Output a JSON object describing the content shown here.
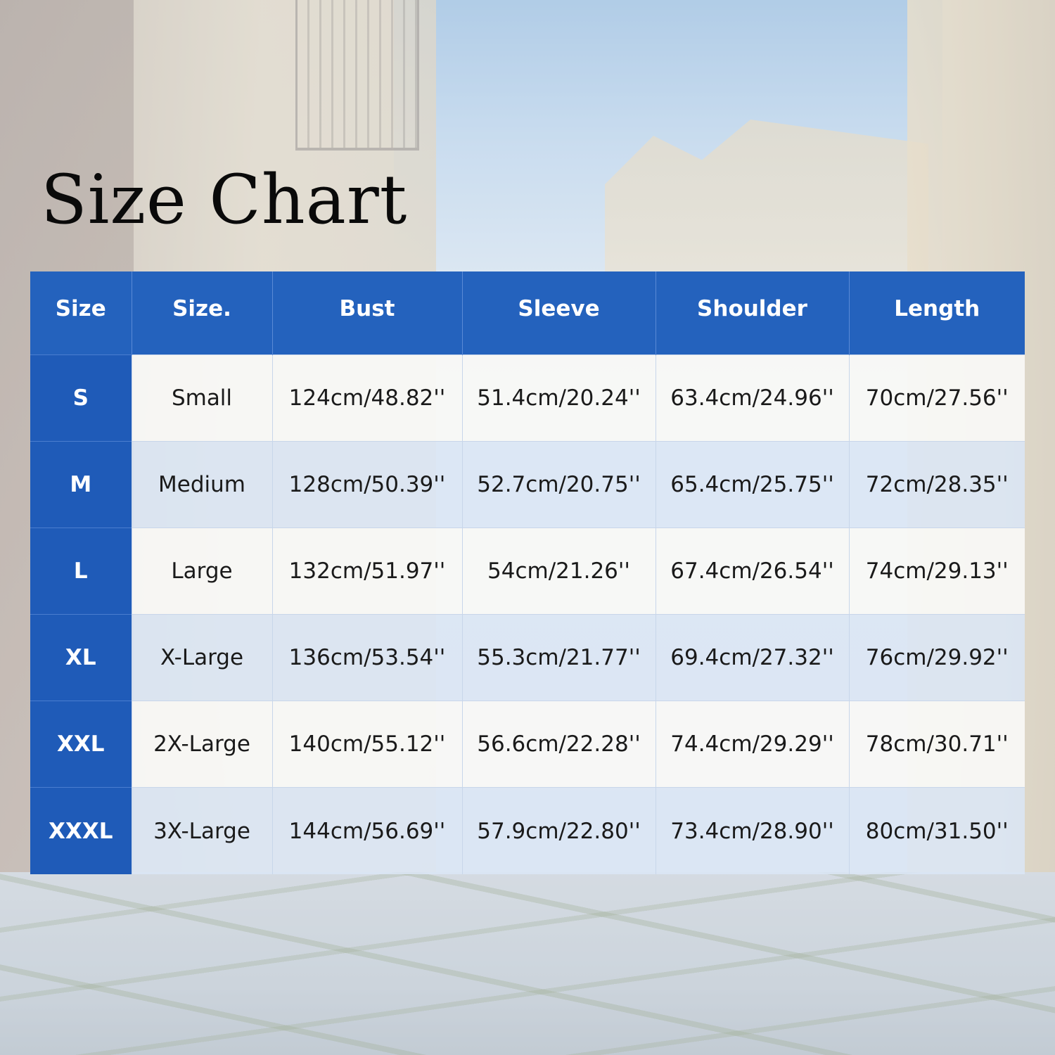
{
  "title": "Size Chart",
  "colors": {
    "header_blue": "#2462bd",
    "size_column_blue": "#1f5bb8",
    "row_light": "#f8f8f6",
    "row_tint": "#dbe6f5"
  },
  "table": {
    "headers": [
      "Size",
      "Size.",
      "Bust",
      "Sleeve",
      "Shoulder",
      "Length"
    ],
    "rows": [
      [
        "S",
        "Small",
        "124cm/48.82''",
        "51.4cm/20.24''",
        "63.4cm/24.96''",
        "70cm/27.56''"
      ],
      [
        "M",
        "Medium",
        "128cm/50.39''",
        "52.7cm/20.75''",
        "65.4cm/25.75''",
        "72cm/28.35''"
      ],
      [
        "L",
        "Large",
        "132cm/51.97''",
        "54cm/21.26''",
        "67.4cm/26.54''",
        "74cm/29.13''"
      ],
      [
        "XL",
        "X-Large",
        "136cm/53.54''",
        "55.3cm/21.77''",
        "69.4cm/27.32''",
        "76cm/29.92''"
      ],
      [
        "XXL",
        "2X-Large",
        "140cm/55.12''",
        "56.6cm/22.28''",
        "74.4cm/29.29''",
        "78cm/30.71''"
      ],
      [
        "XXXL",
        "3X-Large",
        "144cm/56.69''",
        "57.9cm/22.80''",
        "73.4cm/28.90''",
        "80cm/31.50''"
      ]
    ]
  }
}
